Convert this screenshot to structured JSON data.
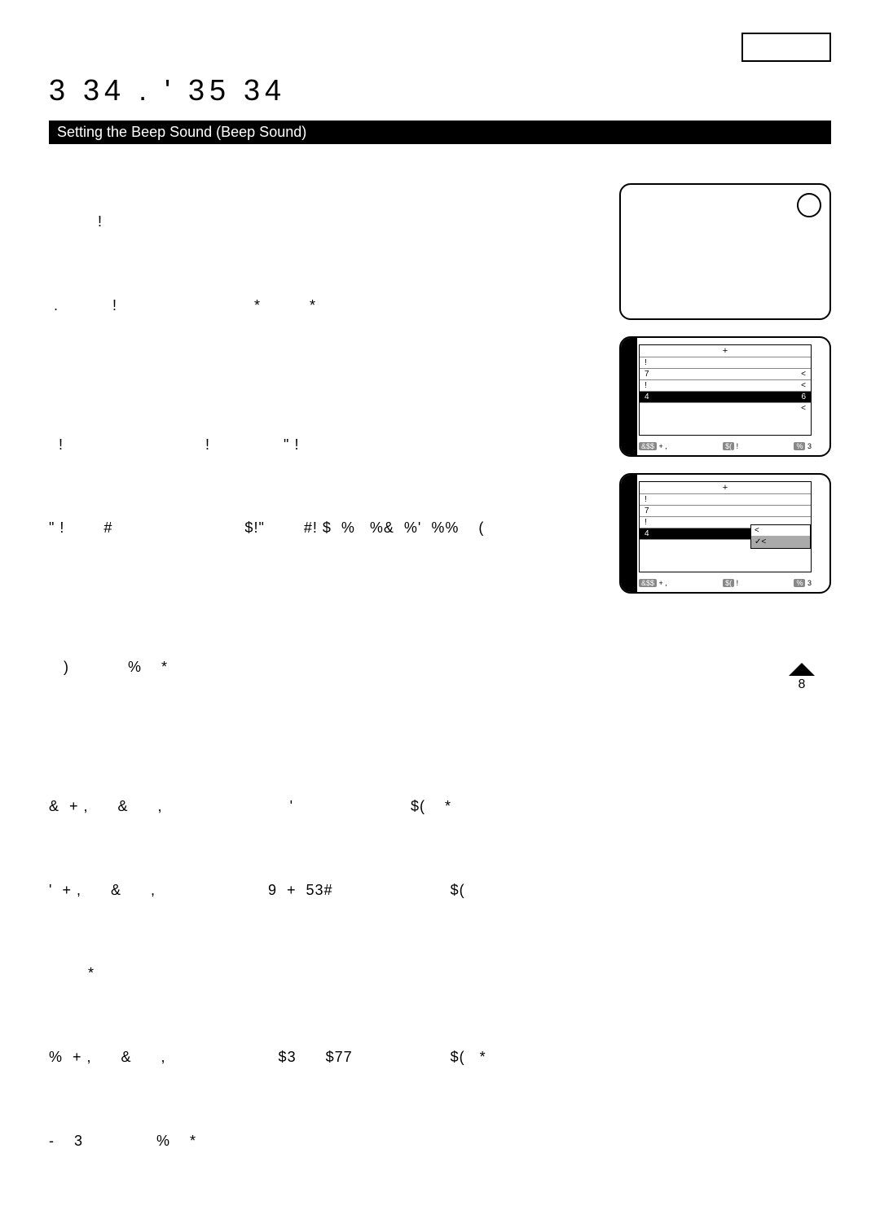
{
  "chapter_title": "3      34 . '   35    34",
  "section_bar": "Setting the Beep Sound (Beep Sound)",
  "body_lines": [
    "          !",
    " .           !                            *          *",
    "",
    "  !                             !               \" !",
    "\" !        #                           $!\"        #! $  %   %&  %'  %%    (",
    "",
    "   )            %    *",
    "",
    "&  + ,      &      ,                          '                        $(    *",
    "'  + ,      &      ,                       9  +  53#                        $(",
    "        *",
    "%  + ,      &      ,                       $3      $77                    $(   *",
    "-    3               %    *"
  ],
  "illustration": {
    "step2_label": "&",
    "step3_label": "%",
    "menu_title": "+",
    "menu_rows_1": [
      {
        "left": "!",
        "right": ""
      },
      {
        "left": "7",
        "right": "<"
      },
      {
        "left": "!",
        "right": "<"
      },
      {
        "left": "4",
        "right": "6",
        "selected": true
      },
      {
        "left": "",
        "right": "<"
      }
    ],
    "menu_rows_2": [
      {
        "left": "!",
        "right": ""
      },
      {
        "left": "7",
        "right": ""
      },
      {
        "left": "!",
        "right": ""
      },
      {
        "left": "4",
        "right": "",
        "selected": true
      },
      {
        "left": "",
        "right": ""
      }
    ],
    "submenu": [
      {
        "label": "<"
      },
      {
        "label": "✓<",
        "selected": true
      }
    ],
    "footer_left": "&$$",
    "footer_mid1": "+ ,",
    "footer_mid2": "$(",
    "footer_mid3": "!",
    "footer_right": "%",
    "footer_last": "3"
  },
  "page_number": "8"
}
